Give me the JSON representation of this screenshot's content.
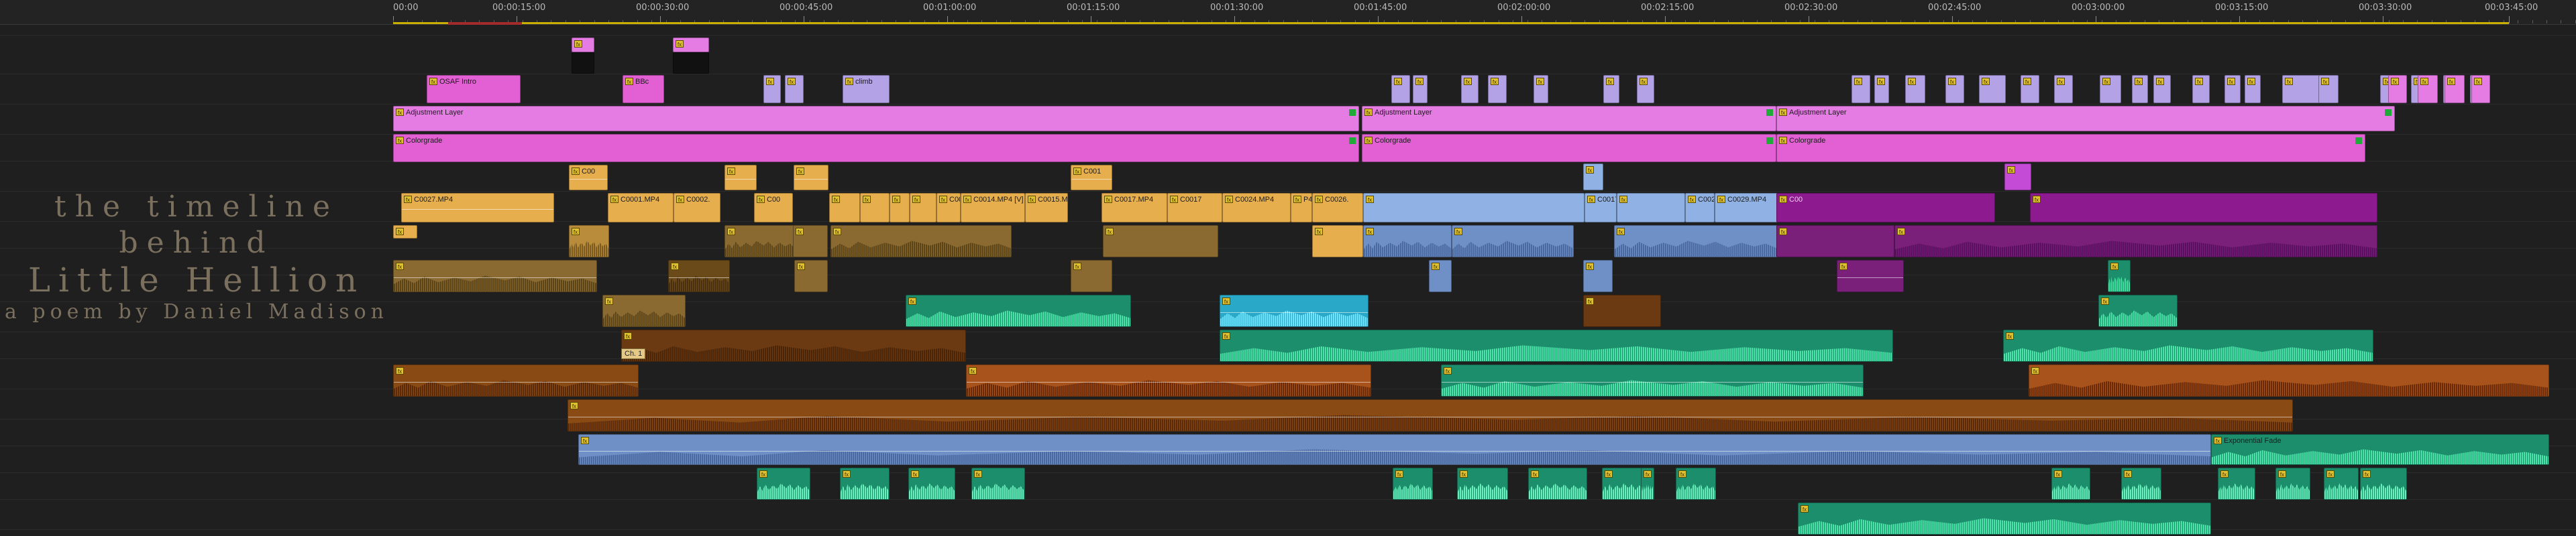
{
  "ruler": {
    "ticks": [
      "00:00",
      "00:00:15:00",
      "00:00:30:00",
      "00:00:45:00",
      "00:01:00:00",
      "00:01:15:00",
      "00:01:30:00",
      "00:01:45:00",
      "00:02:00:00",
      "00:02:15:00",
      "00:02:30:00",
      "00:02:45:00",
      "00:03:00:00",
      "00:03:15:00",
      "00:03:30:00",
      "00:03:45:00"
    ]
  },
  "poem": {
    "line1": "the timeline",
    "line2": "behind",
    "line3": "Little Hellion",
    "line4": "a poem by Daniel Madison"
  },
  "labels": {
    "osaf": "OSAF Intro",
    "bbc": "BBc",
    "climb": "climb",
    "adj": "Adjustment Layer",
    "adj_r": "djustment Layer",
    "color": "Colorgrade",
    "c00": "C00",
    "c001": "C001",
    "c0027": "C0027.MP4",
    "c0001": "C0001.MP4",
    "c0002": "C0002.",
    "c0013": "C0013.",
    "c0014": "C0014.MP4 [V]",
    "c0015": "C0015.M",
    "c0017": "C0017.MP4",
    "c0017b": "C0017",
    "c0024": "C0024.MP4",
    "p4": "P4",
    "c0026": "C0026.",
    "c0017c": "C0017.",
    "c002": "C002",
    "c0029": "C0029.MP4",
    "ch1": "Ch. 1",
    "expfade": "Exponential Fade",
    "fx": "fx",
    "inx": "in x"
  }
}
